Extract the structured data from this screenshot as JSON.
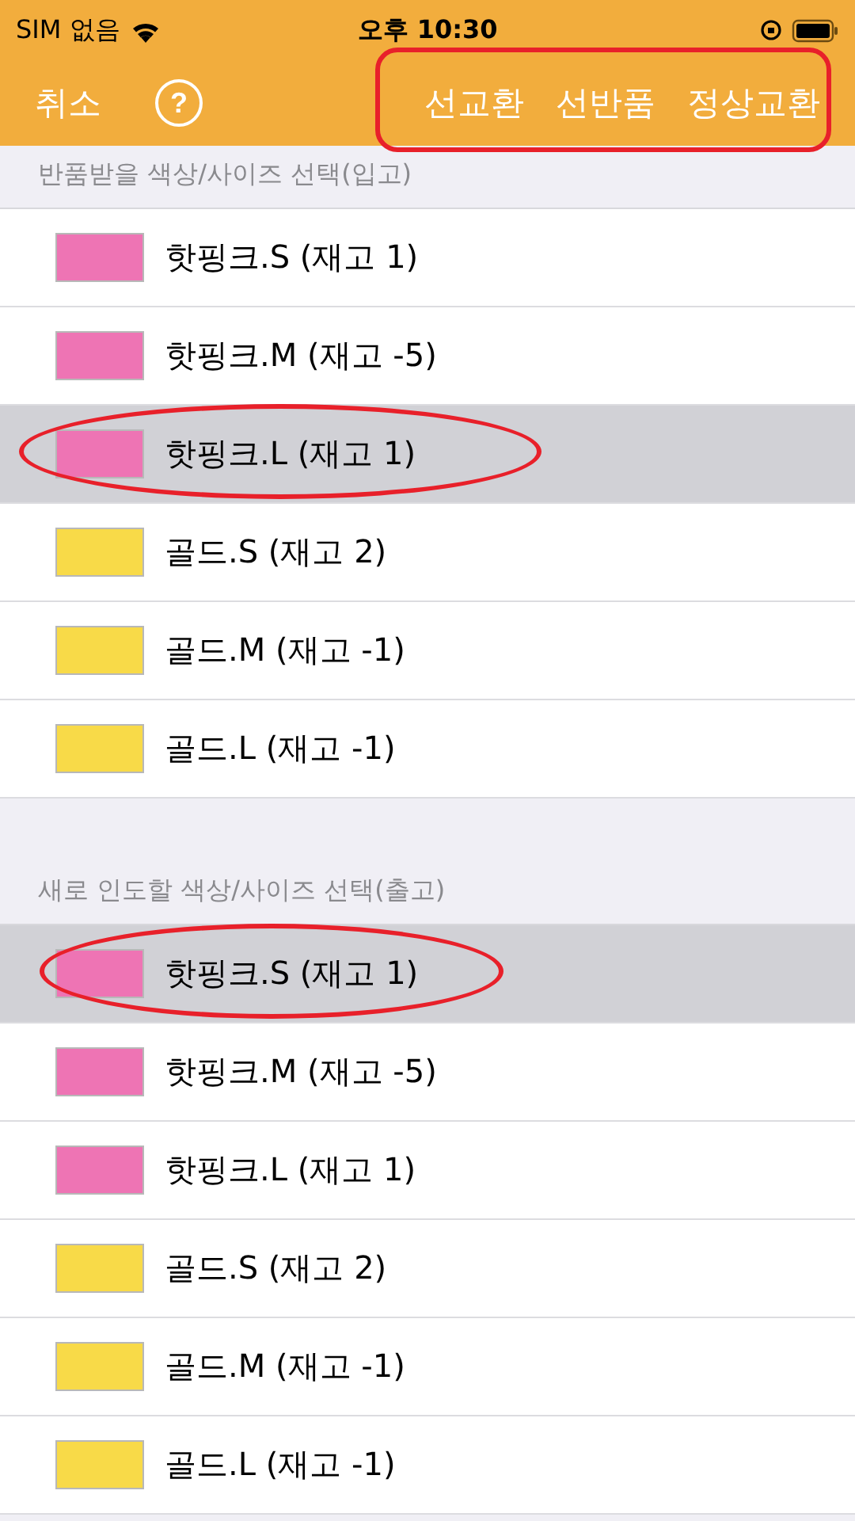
{
  "status_bar": {
    "carrier": "SIM 없음",
    "time": "오후 10:30"
  },
  "nav_bar": {
    "cancel": "취소",
    "help": "?",
    "actions": [
      "선교환",
      "선반품",
      "정상교환"
    ],
    "actions_annotated": true
  },
  "sections": [
    {
      "title": "반품받을 색상/사이즈 선택(입고)",
      "items": [
        {
          "label": "핫핑크.S (재고 1)",
          "color": "#ee74b4",
          "selected": false,
          "annotated": false
        },
        {
          "label": "핫핑크.M (재고 -5)",
          "color": "#ee74b4",
          "selected": false,
          "annotated": false
        },
        {
          "label": "핫핑크.L (재고 1)",
          "color": "#ee74b4",
          "selected": true,
          "annotated": true
        },
        {
          "label": "골드.S (재고 2)",
          "color": "#f8da48",
          "selected": false,
          "annotated": false
        },
        {
          "label": "골드.M (재고 -1)",
          "color": "#f8da48",
          "selected": false,
          "annotated": false
        },
        {
          "label": "골드.L (재고 -1)",
          "color": "#f8da48",
          "selected": false,
          "annotated": false
        }
      ]
    },
    {
      "title": "새로 인도할 색상/사이즈 선택(출고)",
      "items": [
        {
          "label": "핫핑크.S (재고 1)",
          "color": "#ee74b4",
          "selected": true,
          "annotated": true
        },
        {
          "label": "핫핑크.M (재고 -5)",
          "color": "#ee74b4",
          "selected": false,
          "annotated": false
        },
        {
          "label": "핫핑크.L (재고 1)",
          "color": "#ee74b4",
          "selected": false,
          "annotated": false
        },
        {
          "label": "골드.S (재고 2)",
          "color": "#f8da48",
          "selected": false,
          "annotated": false
        },
        {
          "label": "골드.M (재고 -1)",
          "color": "#f8da48",
          "selected": false,
          "annotated": false
        },
        {
          "label": "골드.L (재고 -1)",
          "color": "#f8da48",
          "selected": false,
          "annotated": false
        }
      ]
    }
  ]
}
